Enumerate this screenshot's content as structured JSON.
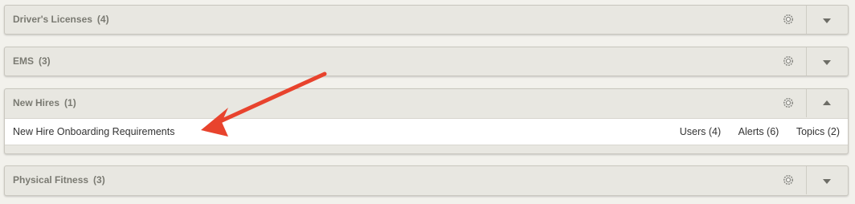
{
  "groups": [
    {
      "label": "Driver's Licenses",
      "count": "(4)",
      "expanded": false
    },
    {
      "label": "EMS",
      "count": "(3)",
      "expanded": false
    },
    {
      "label": "New Hires",
      "count": "(1)",
      "expanded": true,
      "items": [
        {
          "title": "New Hire Onboarding Requirements",
          "users": "Users (4)",
          "alerts": "Alerts (6)",
          "topics": "Topics (2)"
        }
      ]
    },
    {
      "label": "Physical Fitness",
      "count": "(3)",
      "expanded": false
    }
  ],
  "icons": {
    "settings": "gear-icon",
    "collapse": "chevron-up-icon",
    "expand": "chevron-down-icon",
    "annotation": "arrow-annotation"
  },
  "colors": {
    "annotation_arrow": "#e8432d",
    "panel_bg": "#e8e7e1",
    "header_text": "#7a7a72"
  }
}
